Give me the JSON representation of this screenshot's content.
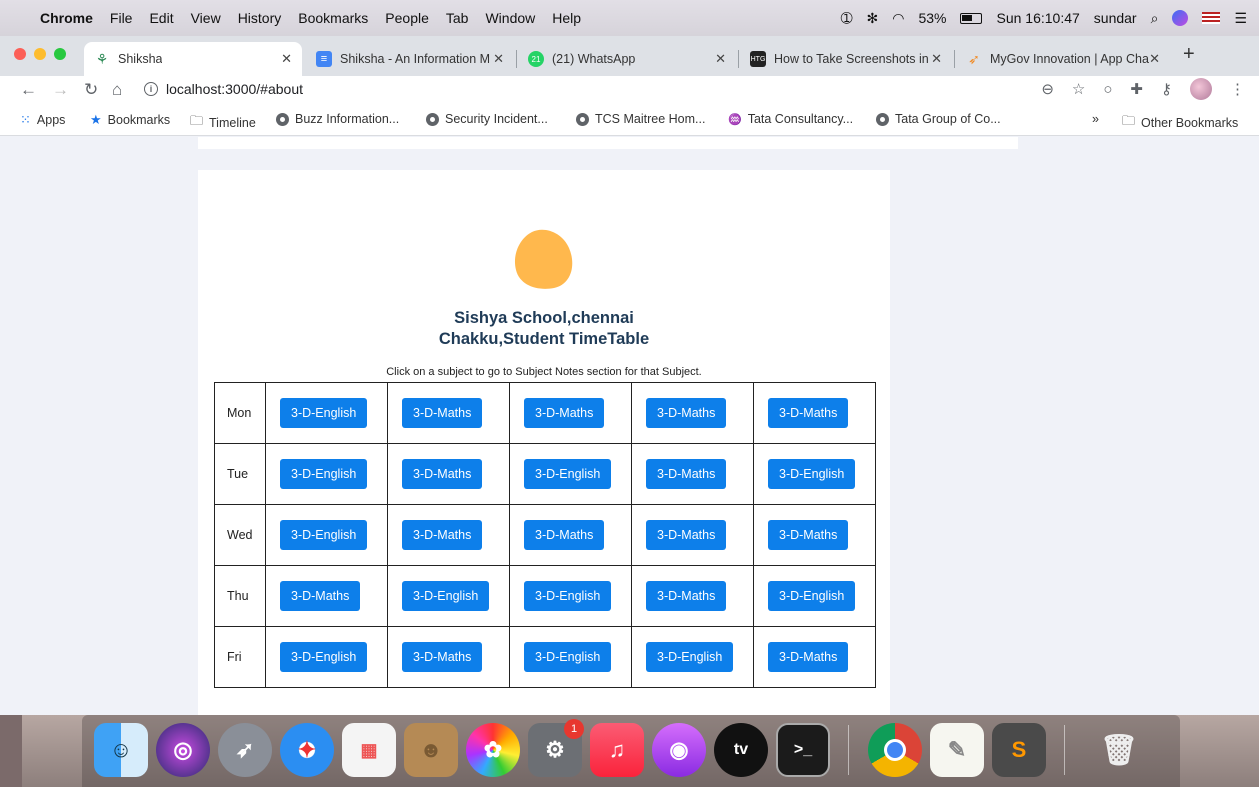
{
  "menubar": {
    "app": "Chrome",
    "items": [
      "File",
      "Edit",
      "View",
      "History",
      "Bookmarks",
      "People",
      "Tab",
      "Window",
      "Help"
    ],
    "battery": "53%",
    "clock": "Sun 16:10:47",
    "user": "sundar"
  },
  "tabs": [
    {
      "title": "Shiksha",
      "active": true
    },
    {
      "title": "Shiksha - An Information Ma",
      "active": false
    },
    {
      "title": "(21) WhatsApp",
      "active": false
    },
    {
      "title": "How to Take Screenshots in",
      "active": false
    },
    {
      "title": "MyGov Innovation | App Cha",
      "active": false
    }
  ],
  "toolbar": {
    "url": "localhost:3000/#about"
  },
  "bookmarks": {
    "apps": "Apps",
    "items": [
      "Bookmarks",
      "Timeline",
      "Buzz Information...",
      "Security Incident...",
      "TCS Maitree Hom...",
      "Tata Consultancy...",
      "Tata Group of Co..."
    ],
    "overflow": "»",
    "other": "Other Bookmarks"
  },
  "page": {
    "title_line1": "Sishya School,chennai",
    "title_line2": "Chakku,Student TimeTable",
    "hint": "Click on a subject to go to Subject Notes section for that Subject.",
    "accent_color": "#0d7fea",
    "blob_color": "#ffb84d"
  },
  "timetable": {
    "rows": [
      {
        "day": "Mon",
        "subjects": [
          "3-D-English",
          "3-D-Maths",
          "3-D-Maths",
          "3-D-Maths",
          "3-D-Maths"
        ]
      },
      {
        "day": "Tue",
        "subjects": [
          "3-D-English",
          "3-D-Maths",
          "3-D-English",
          "3-D-Maths",
          "3-D-English"
        ]
      },
      {
        "day": "Wed",
        "subjects": [
          "3-D-English",
          "3-D-Maths",
          "3-D-Maths",
          "3-D-Maths",
          "3-D-Maths"
        ]
      },
      {
        "day": "Thu",
        "subjects": [
          "3-D-Maths",
          "3-D-English",
          "3-D-English",
          "3-D-Maths",
          "3-D-English"
        ]
      },
      {
        "day": "Fri",
        "subjects": [
          "3-D-English",
          "3-D-Maths",
          "3-D-English",
          "3-D-English",
          "3-D-Maths"
        ]
      }
    ]
  },
  "dock": {
    "apps": [
      "finder-icon",
      "siri-icon",
      "launchpad-icon",
      "safari-icon",
      "grid-app-icon",
      "contacts-icon",
      "photos-icon",
      "system-preferences-icon",
      "music-icon",
      "podcasts-icon",
      "apple-tv-icon",
      "terminal-icon",
      "chrome-icon",
      "textedit-icon",
      "sublime-text-icon",
      "trash-icon"
    ],
    "badge": "1",
    "tv_label": "tv"
  }
}
